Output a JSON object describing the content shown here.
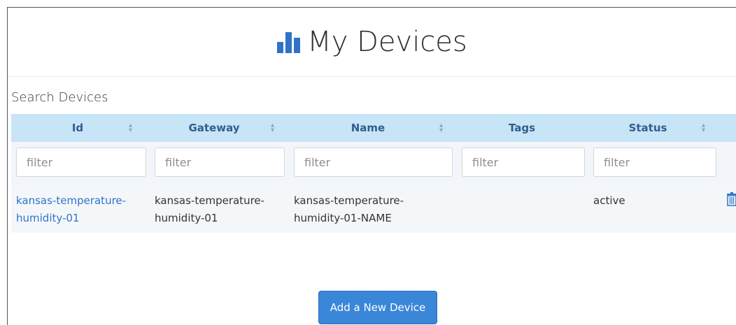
{
  "page": {
    "title": "My Devices",
    "title_icon": "bar-chart-icon",
    "accent_color": "#2f73c8"
  },
  "search": {
    "label": "Search Devices"
  },
  "table": {
    "columns": [
      {
        "label": "Id",
        "sortable": true
      },
      {
        "label": "Gateway",
        "sortable": true
      },
      {
        "label": "Name",
        "sortable": true
      },
      {
        "label": "Tags",
        "sortable": false
      },
      {
        "label": "Status",
        "sortable": true
      }
    ],
    "filter_placeholder": "filter",
    "rows": [
      {
        "id_line1": "kansas-temperature-",
        "id_line2": "humidity-01",
        "gateway_line1": "kansas-temperature-",
        "gateway_line2": "humidity-01",
        "name_line1": "kansas-temperature-",
        "name_line2": "humidity-01-NAME",
        "tags": "",
        "status": "active",
        "action_icon": "trash-icon"
      }
    ]
  },
  "actions": {
    "add_label": "Add a New Device"
  }
}
